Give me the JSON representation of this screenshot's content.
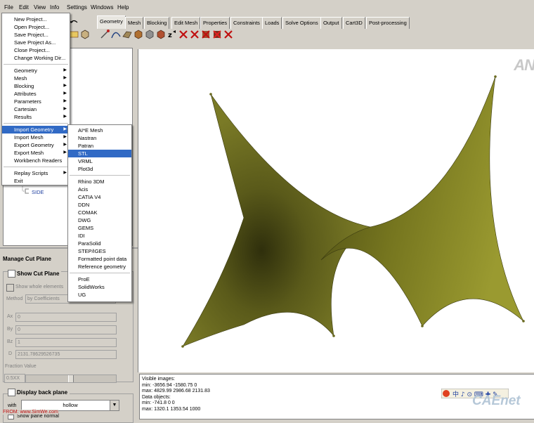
{
  "menubar": {
    "items": [
      "File",
      "Edit",
      "View",
      "Info",
      "Settings",
      "Windows",
      "Help"
    ]
  },
  "tabs": [
    "Geometry",
    "Mesh",
    "Blocking",
    "Edit Mesh",
    "Properties",
    "Constraints",
    "Loads",
    "Solve Options",
    "Output",
    "Cart3D",
    "Post-processing"
  ],
  "file_menu": {
    "items": [
      {
        "label": "New Project..."
      },
      {
        "label": "Open Project..."
      },
      {
        "label": "Save Project..."
      },
      {
        "label": "Save Project As..."
      },
      {
        "label": "Close Project..."
      },
      {
        "label": "Change Working Dir..."
      },
      {
        "label": "Geometry",
        "submenu": true
      },
      {
        "label": "Mesh",
        "submenu": true
      },
      {
        "label": "Blocking",
        "submenu": true
      },
      {
        "label": "Attributes",
        "submenu": true
      },
      {
        "label": "Parameters",
        "submenu": true
      },
      {
        "label": "Cartesian",
        "submenu": true
      },
      {
        "label": "Results",
        "submenu": true
      },
      {
        "label": "Import Geometry",
        "submenu": true,
        "highlighted": true
      },
      {
        "label": "Import Mesh",
        "submenu": true
      },
      {
        "label": "Export Geometry",
        "submenu": true
      },
      {
        "label": "Export Mesh",
        "submenu": true
      },
      {
        "label": "Workbench Readers"
      },
      {
        "label": "Replay Scripts",
        "submenu": true
      },
      {
        "label": "Exit"
      }
    ]
  },
  "import_geometry_menu": {
    "items": [
      {
        "label": "AI*E Mesh"
      },
      {
        "label": "Nastran"
      },
      {
        "label": "Patran"
      },
      {
        "label": "STL",
        "highlighted": true
      },
      {
        "label": "VRML"
      },
      {
        "label": "Plot3d"
      },
      {
        "label": "Rhino 3DM"
      },
      {
        "label": "Acis"
      },
      {
        "label": "CATIA V4"
      },
      {
        "label": "DDN"
      },
      {
        "label": "COMAK"
      },
      {
        "label": "DWG"
      },
      {
        "label": "GEMS"
      },
      {
        "label": "IDI"
      },
      {
        "label": "ParaSolid"
      },
      {
        "label": "STEP/IGES"
      },
      {
        "label": "Formatted point data"
      },
      {
        "label": "Reference geometry"
      },
      {
        "label": "ProE"
      },
      {
        "label": "SolidWorks"
      },
      {
        "label": "UG"
      }
    ]
  },
  "tree": {
    "items": [
      "SIDE"
    ]
  },
  "cut_plane": {
    "title": "Manage Cut Plane",
    "show_label": "Show Cut Plane",
    "show_whole_label": "Show whole elements",
    "method_label": "Method",
    "method_value": "by Coefficients",
    "ax_label": "Ax",
    "ax_value": "0",
    "by_label": "By",
    "by_value": "0",
    "bz_label": "Bz",
    "bz_value": "1",
    "d_label": "D",
    "d_value": "2131.78629526735",
    "fraction_label": "Fraction Value",
    "fraction_value": "0.5XX"
  },
  "back_plane": {
    "title": "Display back plane",
    "with_label": "with",
    "with_value": "hollow",
    "show_plane_normal": "Show plane normal"
  },
  "info": {
    "lines": [
      "Visible images:",
      "   min: -3656.94 -1580.75 0",
      "   max: 4829.99 2986.68 2131.83",
      "Data objects:",
      "   min: -741.8 0 0",
      "   max: 1320.1 1353.54 1000"
    ]
  },
  "viewport": {
    "corner_logo": "AN"
  },
  "watermarks": {
    "from_text": "FROM: www.SimWe.com",
    "caenet": "CAEnet"
  },
  "colors": {
    "surface_main": "#6b6b1e",
    "surface_light": "#8b8b2a",
    "surface_dark": "#3a3a10",
    "menu_highlight": "#316ac5",
    "chrome": "#d4d0c8"
  }
}
